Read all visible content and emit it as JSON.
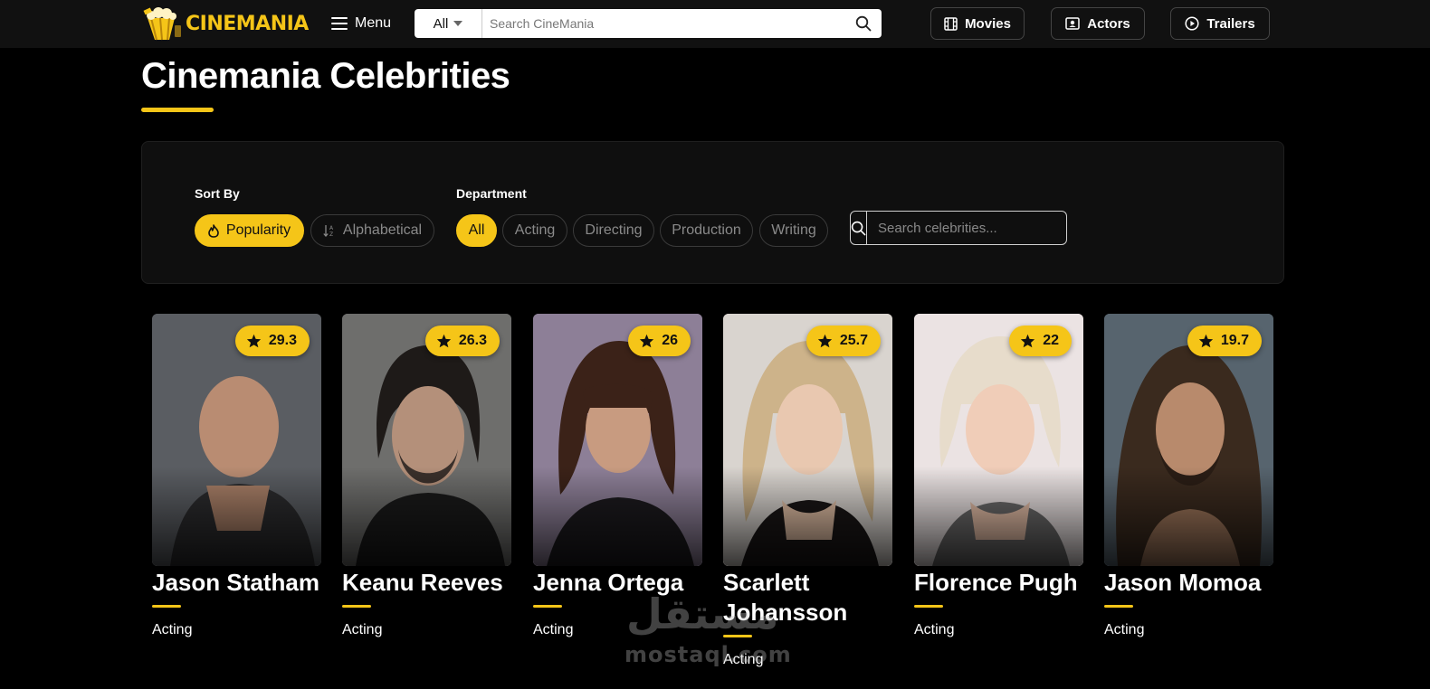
{
  "header": {
    "logo_text": "CINEMANIA",
    "menu_label": "Menu",
    "search": {
      "category": "All",
      "placeholder": "Search CineMania"
    },
    "nav": {
      "movies": "Movies",
      "actors": "Actors",
      "trailers": "Trailers"
    }
  },
  "page": {
    "title": "Cinemania Celebrities"
  },
  "filters": {
    "sort_label": "Sort By",
    "sort_options": [
      "Popularity",
      "Alphabetical"
    ],
    "sort_selected": "Popularity",
    "department_label": "Department",
    "departments": [
      "All",
      "Acting",
      "Directing",
      "Production",
      "Writing"
    ],
    "department_selected": "All",
    "search_placeholder": "Search celebrities..."
  },
  "celebrities": [
    {
      "name": "Jason Statham",
      "rating": "29.3",
      "department": "Acting",
      "photo_bg": "#5a5d62"
    },
    {
      "name": "Keanu Reeves",
      "rating": "26.3",
      "department": "Acting",
      "photo_bg": "#6e6e6c"
    },
    {
      "name": "Jenna Ortega",
      "rating": "26",
      "department": "Acting",
      "photo_bg": "#8d7f97"
    },
    {
      "name": "Scarlett Johansson",
      "rating": "25.7",
      "department": "Acting",
      "photo_bg": "#d9d4cf"
    },
    {
      "name": "Florence Pugh",
      "rating": "22",
      "department": "Acting",
      "photo_bg": "#ebe3e3"
    },
    {
      "name": "Jason Momoa",
      "rating": "19.7",
      "department": "Acting",
      "photo_bg": "#57646e"
    }
  ],
  "watermark": {
    "arabic": "مستقل",
    "latin": "mostaql.com"
  },
  "colors": {
    "accent": "#f5c518",
    "background": "#000000",
    "panel": "#0f0f0f"
  }
}
